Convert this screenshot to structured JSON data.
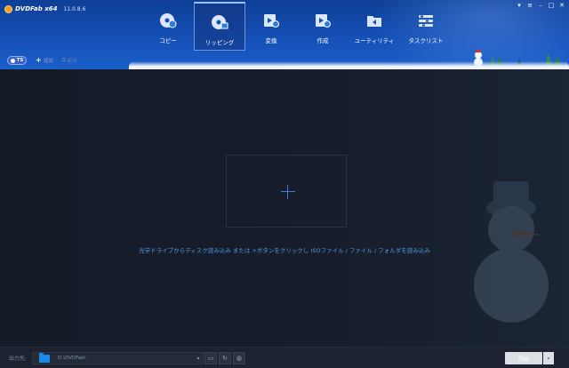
{
  "app": {
    "name": "DVDFab x64",
    "version": "11.0.8.6"
  },
  "window_controls": [
    "pin-icon",
    "menu-icon",
    "minimize-icon",
    "maximize-icon",
    "close-icon"
  ],
  "nav": {
    "items": [
      {
        "label": "コピー",
        "icon": "disc-copy-icon",
        "active": false
      },
      {
        "label": "リッピング",
        "icon": "disc-ripper-icon",
        "active": true
      },
      {
        "label": "変換",
        "icon": "video-convert-icon",
        "active": false
      },
      {
        "label": "作成",
        "icon": "video-create-icon",
        "active": false
      },
      {
        "label": "ユーティリティ",
        "icon": "utility-folder-icon",
        "active": false
      },
      {
        "label": "タスクリスト",
        "icon": "task-list-icon",
        "active": false
      }
    ]
  },
  "toolbar": {
    "ts_label": "TS",
    "add_label": "追加",
    "merge_label": "結合"
  },
  "main": {
    "hint": "光学ドライブからディスク読み込み または +ボタンをクリックし ISOファイル / ファイル / フォルダを読み込み"
  },
  "bottom": {
    "output_label": "出力先:",
    "output_path": "D:\\DVDFab\\",
    "start_label": "開始"
  },
  "colors": {
    "header": "#1550b6",
    "background": "#161b28",
    "hint_text": "#4f9ce6",
    "accent": "#3d7bd8"
  }
}
